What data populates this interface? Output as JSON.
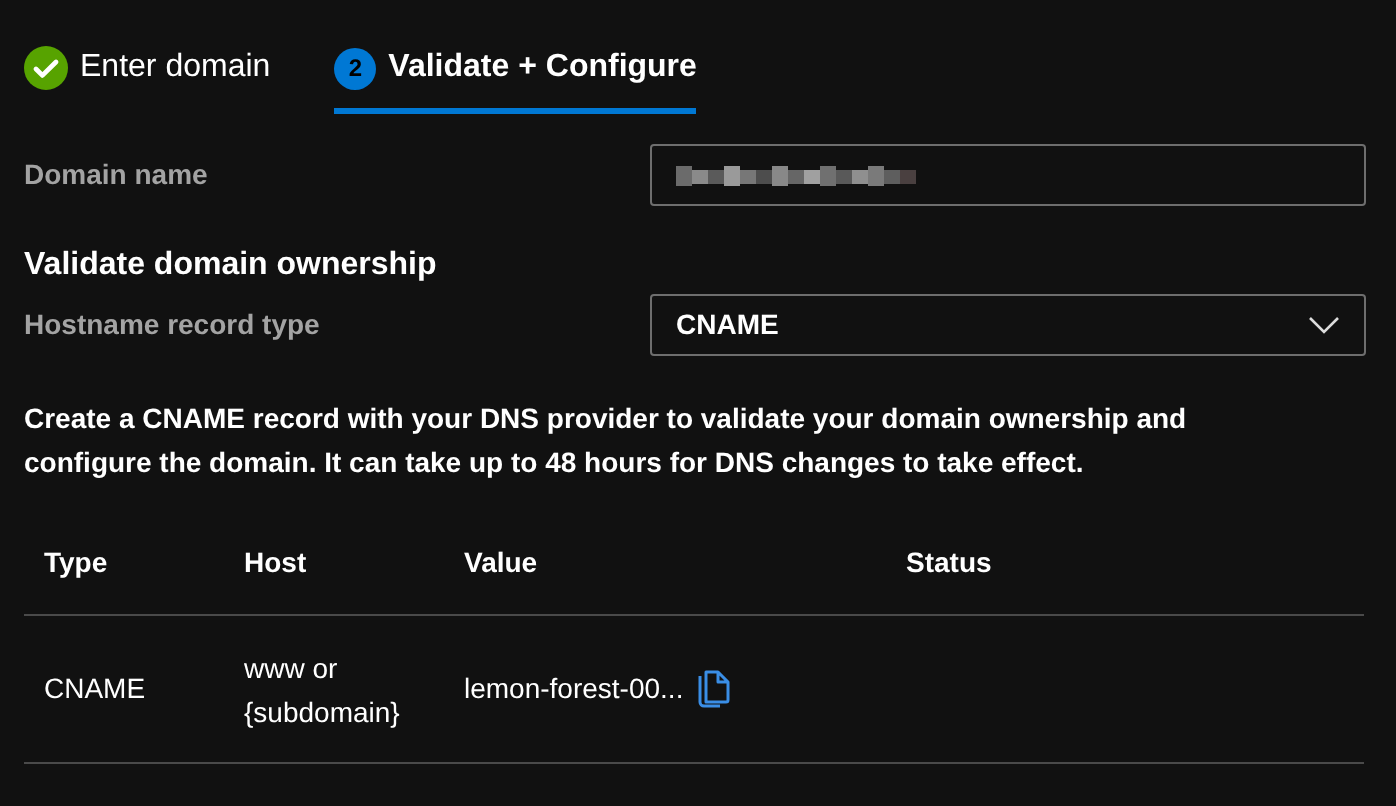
{
  "steps": [
    {
      "label": "Enter domain",
      "kind": "done",
      "selected": false
    },
    {
      "label": "Validate + Configure",
      "number": "2",
      "kind": "current",
      "selected": true
    }
  ],
  "domain_field": {
    "label": "Domain name",
    "value_redacted": true
  },
  "section_title": "Validate domain ownership",
  "record_type": {
    "label": "Hostname record type",
    "value": "CNAME"
  },
  "instructions": "Create a CNAME record with your DNS provider to validate your domain ownership and configure the domain. It can take up to 48 hours for DNS changes to take effect.",
  "table": {
    "columns": [
      "Type",
      "Host",
      "Value",
      "Status"
    ],
    "rows": [
      {
        "type": "CNAME",
        "host": "www or {subdomain}",
        "value": "lemon-forest-00...",
        "copyable": true
      }
    ]
  }
}
